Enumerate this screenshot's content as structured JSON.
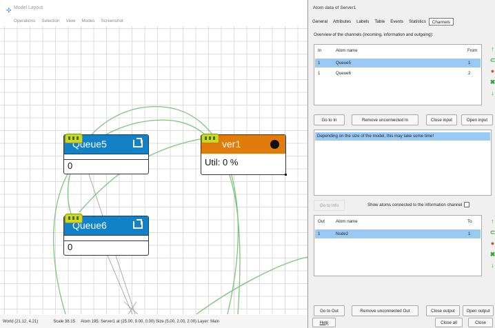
{
  "model_window": {
    "title": "Model Layout",
    "menu": [
      "Operations",
      "Selection",
      "View",
      "Modes",
      "Screenshot"
    ]
  },
  "atoms": {
    "queue5": {
      "name": "Queue5",
      "value": "0",
      "color": "#1381c6"
    },
    "queue6": {
      "name": "Queue6",
      "value": "0",
      "color": "#1381c6"
    },
    "server1": {
      "name": "Server1",
      "display_name": "ver1",
      "value": "Util: 0 %",
      "color": "#e07b0c"
    }
  },
  "statusbar": {
    "world": "World (21.12, 4.21)",
    "scale": "Scale 38.15",
    "atom_info": "Atom 195: Server1 at (25.00, 9.00, 0.00) Size (5.00, 2.00, 2.00) Layer: Main"
  },
  "panel": {
    "title": "Atom data of Server1",
    "tabs": [
      "General",
      "Attributes",
      "Labels",
      "Table",
      "Events",
      "Statistics",
      "Channels"
    ],
    "active_tab": "Channels",
    "overview": "Overview of the channels (incoming, information and outgoing):",
    "in_table": {
      "headers": [
        "In",
        "Atom name",
        "From"
      ],
      "rows": [
        {
          "num": "1",
          "name": "Queue5",
          "from": "1",
          "selected": true
        },
        {
          "num": "1",
          "name": "Queue6",
          "from": "2",
          "selected": false
        }
      ]
    },
    "in_buttons": {
      "goto": "Go to In",
      "remove": "Remove unconnected In",
      "close": "Close input",
      "open": "Open input"
    },
    "info_message": "Depending on the size of the model, this may take some time!",
    "info_button": "Go to Info",
    "show_atoms_label": "Show atoms connected to the information channel",
    "out_table": {
      "headers": [
        "Out",
        "Atom name",
        "To"
      ],
      "rows": [
        {
          "num": "1",
          "name": "Node2",
          "to": "1",
          "selected": true
        }
      ]
    },
    "out_buttons": {
      "goto": "Go to Out",
      "remove": "Remove unconnected Out",
      "close": "Close output",
      "open": "Open output"
    },
    "footer": {
      "help": "Help",
      "close_all": "Close all",
      "close": "Close"
    }
  },
  "colors": {
    "accent": "#99c9f5",
    "queue_header": "#1381c6",
    "server_header": "#e07b0c",
    "connection": "#7cc47c"
  }
}
